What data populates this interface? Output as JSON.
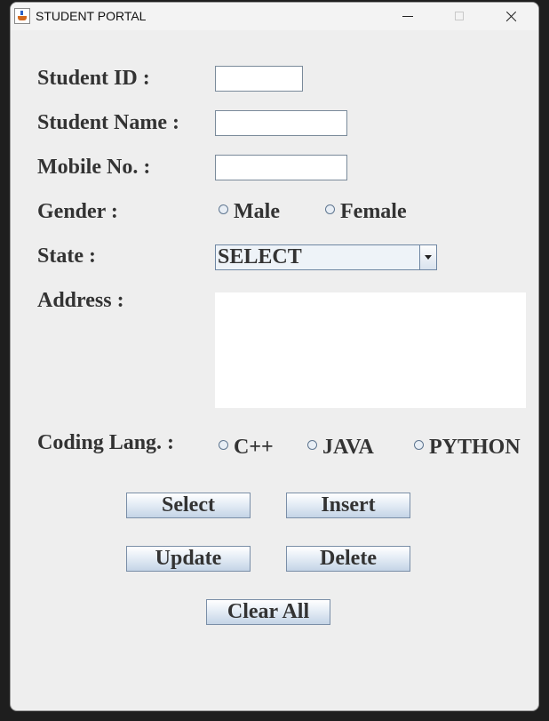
{
  "window": {
    "title": "STUDENT PORTAL"
  },
  "form": {
    "student_id_label": "Student ID :",
    "student_id_value": "",
    "student_name_label": "Student Name :",
    "student_name_value": "",
    "mobile_label": "Mobile No. :",
    "mobile_value": "",
    "gender_label": "Gender :",
    "gender_options": [
      "Male",
      "Female"
    ],
    "state_label": "State :",
    "state_selected": "SELECT",
    "address_label": "Address :",
    "address_value": "",
    "coding_label": "Coding Lang. :",
    "coding_options": [
      "C++",
      "JAVA",
      "PYTHON"
    ]
  },
  "buttons": {
    "select": "Select",
    "insert": "Insert",
    "update": "Update",
    "delete": "Delete",
    "clear_all": "Clear All"
  },
  "icons": {
    "app": "java-cup-icon",
    "minimize": "minimize-icon",
    "maximize": "maximize-icon",
    "close": "close-icon"
  }
}
